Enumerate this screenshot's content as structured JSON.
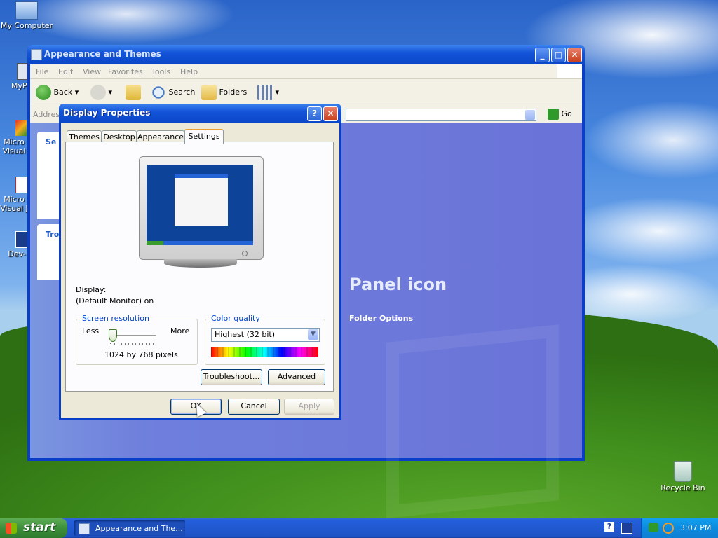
{
  "desktop": {
    "icons": [
      {
        "label": "My Computer"
      },
      {
        "label": "MyP"
      },
      {
        "label": "Micro\nVisual"
      },
      {
        "label": "Micro\nVisual J"
      },
      {
        "label": "Dev-"
      },
      {
        "label": "Recycle Bin"
      }
    ]
  },
  "explorer": {
    "title": "Appearance and Themes",
    "menu": [
      "File",
      "Edit",
      "View",
      "Favorites",
      "Tools",
      "Help"
    ],
    "toolbar": {
      "back": "Back",
      "search": "Search",
      "folders": "Folders"
    },
    "address_label": "Address",
    "go_label": "Go",
    "left_pane": {
      "section1": "Se",
      "section2": "Tro"
    },
    "heading": "Panel icon",
    "link": "Folder Options"
  },
  "dialog": {
    "title": "Display Properties",
    "help_btn": "?",
    "close_btn": "X",
    "tabs": [
      "Themes",
      "Desktop",
      "Appearance",
      "Settings"
    ],
    "active_tab": "Settings",
    "display_label": "Display:",
    "display_value": "(Default Monitor) on",
    "resolution": {
      "group_label": "Screen resolution",
      "less": "Less",
      "more": "More",
      "value_text": "1024 by 768 pixels",
      "slider_level": 0.0
    },
    "color_quality": {
      "group_label": "Color quality",
      "selected": "Highest (32 bit)"
    },
    "buttons": {
      "troubleshoot": "Troubleshoot...",
      "advanced": "Advanced",
      "ok": "OK",
      "cancel": "Cancel",
      "apply": "Apply"
    }
  },
  "taskbar": {
    "start": "start",
    "task": "Appearance and The...",
    "help_icon": "?",
    "clock": "3:07 PM"
  }
}
